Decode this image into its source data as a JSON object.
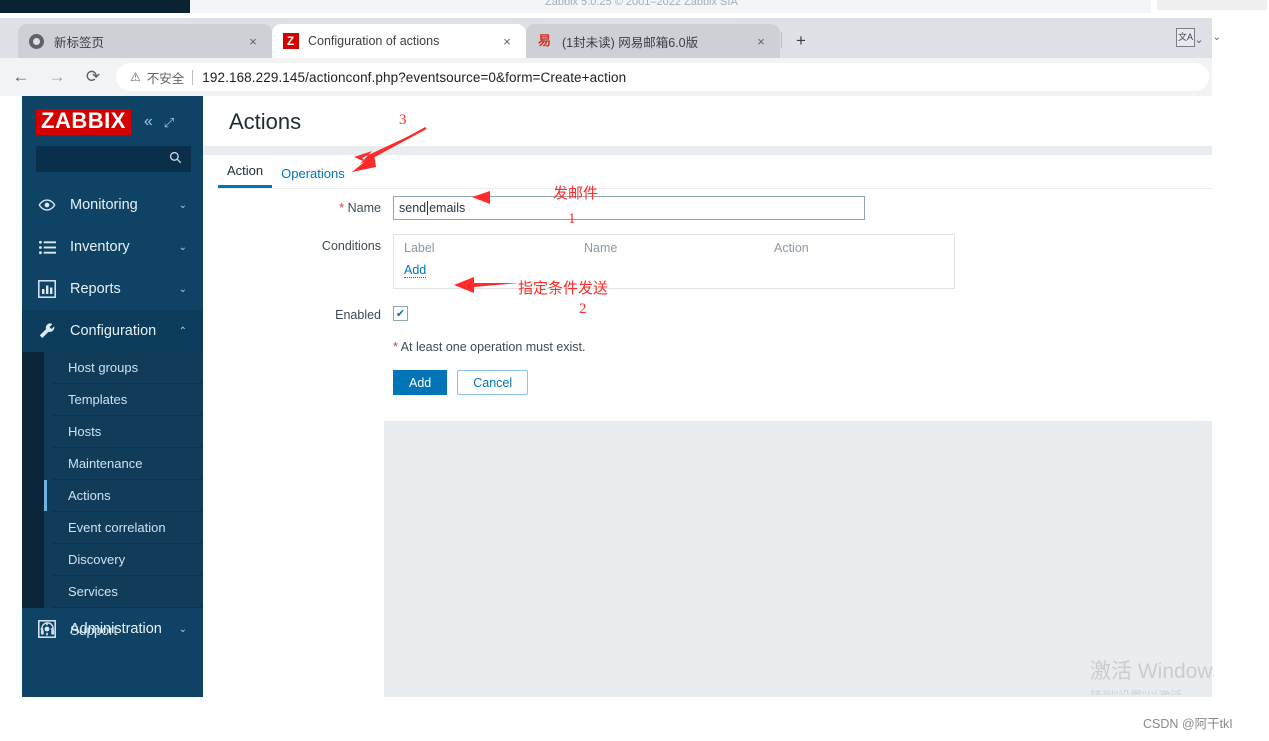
{
  "top_strip": {
    "footer_text": "Zabbix 5.0.25 © 2001–2022 Zabbix SIA"
  },
  "browser": {
    "tabs": [
      {
        "title": "新标签页",
        "favicon": "chrome-icon",
        "active": false,
        "close_label": "×"
      },
      {
        "title": "Configuration of actions",
        "favicon": "zabbix-icon",
        "favicon_text": "Z",
        "active": true,
        "close_label": "×"
      },
      {
        "title": "(1封未读) 网易邮箱6.0版",
        "favicon": "netease-mail-icon",
        "favicon_text": "易",
        "active": false,
        "close_label": "×"
      }
    ],
    "new_tab_label": "+",
    "tab_list_label": "⌄",
    "back_label": "←",
    "forward_label": "→",
    "reload_label": "⟳",
    "security_icon_label": "⚠",
    "security_text": "不安全",
    "url": "192.168.229.145/actionconf.php?eventsource=0&form=Create+action",
    "translate_label": "文A",
    "menu_caret": "⌄"
  },
  "sidebar": {
    "logo": "ZABBIX",
    "collapse_label": "«",
    "expand_label": "⤢",
    "search_placeholder": "",
    "search_icon": "search-icon",
    "items": [
      {
        "label": "Monitoring",
        "icon": "eye-icon",
        "caret": "⌄",
        "expanded": false
      },
      {
        "label": "Inventory",
        "icon": "list-icon",
        "caret": "⌄",
        "expanded": false
      },
      {
        "label": "Reports",
        "icon": "bar-chart-icon",
        "caret": "⌄",
        "expanded": false
      },
      {
        "label": "Configuration",
        "icon": "wrench-icon",
        "caret": "⌃",
        "expanded": true
      }
    ],
    "subitems": [
      {
        "label": "Host groups",
        "active": false
      },
      {
        "label": "Templates",
        "active": false
      },
      {
        "label": "Hosts",
        "active": false
      },
      {
        "label": "Maintenance",
        "active": false
      },
      {
        "label": "Actions",
        "active": true
      },
      {
        "label": "Event correlation",
        "active": false
      },
      {
        "label": "Discovery",
        "active": false
      },
      {
        "label": "Services",
        "active": false
      }
    ],
    "administration": {
      "label": "Administration",
      "icon": "gear-icon",
      "caret": "⌄"
    },
    "support": {
      "label": "Support",
      "icon": "headset-icon"
    }
  },
  "page": {
    "title": "Actions",
    "tabs": [
      {
        "label": "Action",
        "active": true
      },
      {
        "label": "Operations",
        "active": false
      }
    ],
    "form": {
      "name_label": "Name",
      "name_required": "*",
      "name_value_before_caret": "send ",
      "name_value_after_caret": "emails",
      "conditions_label": "Conditions",
      "conditions_columns": [
        "Label",
        "Name",
        "Action"
      ],
      "conditions_add_link": "Add",
      "enabled_label": "Enabled",
      "enabled_checked": true,
      "enabled_check_glyph": "✔",
      "operation_hint_required": "*",
      "operation_hint": "At least one operation must exist.",
      "submit_label": "Add",
      "cancel_label": "Cancel"
    }
  },
  "annotations": [
    {
      "id": "num-3",
      "text": "3",
      "type": "number"
    },
    {
      "id": "num-1",
      "text": "1",
      "type": "number"
    },
    {
      "id": "num-2",
      "text": "2",
      "type": "number"
    },
    {
      "id": "cn-send-mail",
      "text": "发邮件",
      "type": "chinese-note"
    },
    {
      "id": "cn-condition",
      "text": "指定条件发送",
      "type": "chinese-note"
    }
  ],
  "watermarks": {
    "windows_line1": "激活 Windows",
    "windows_line2": "转到\"设置\"以激活",
    "csdn": "CSDN @阿干tkI"
  },
  "colors": {
    "zabbix_red": "#d40000",
    "sidebar_blue": "#0f4366",
    "accent_blue": "#0275b8",
    "annotation_red": "#ff2a2a"
  }
}
